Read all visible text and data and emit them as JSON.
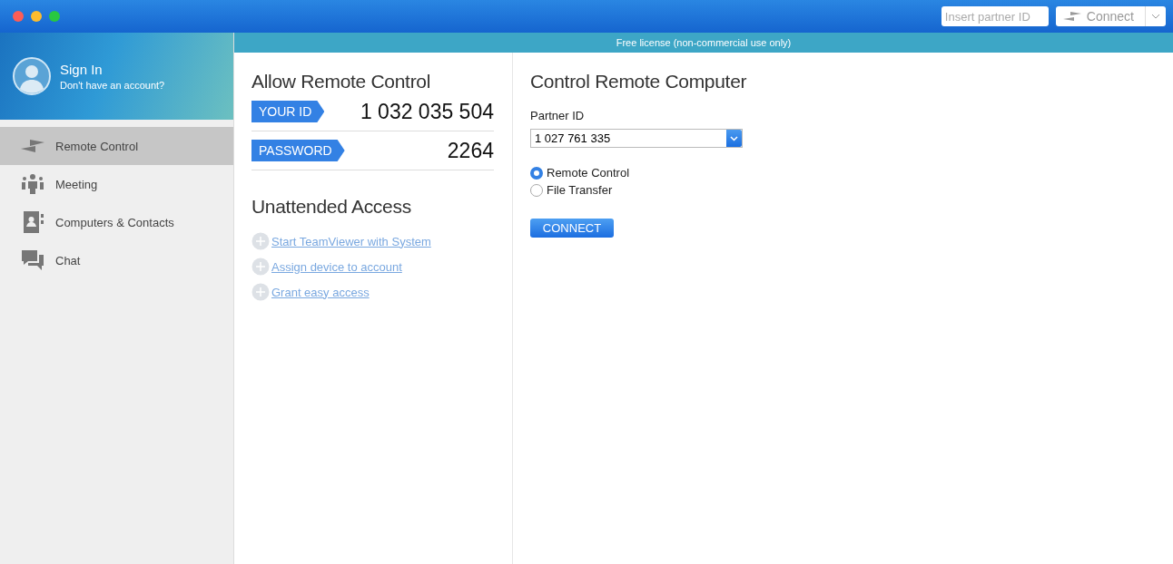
{
  "toolbar": {
    "partner_field": {
      "placeholder": "Insert partner ID"
    },
    "connect_button": "Connect"
  },
  "banner": "Free license (non-commercial use only)",
  "account": {
    "title": "Sign In",
    "subtitle": "Don't have an account?"
  },
  "sidebar": {
    "items": [
      {
        "label": "Remote Control",
        "kind": "arrows",
        "selected": true
      },
      {
        "label": "Meeting",
        "kind": "people",
        "selected": false
      },
      {
        "label": "Computers & Contacts",
        "kind": "contacts",
        "selected": false
      },
      {
        "label": "Chat",
        "kind": "chat",
        "selected": false
      }
    ]
  },
  "allow": {
    "title": "Allow Remote Control",
    "rows": [
      {
        "label": "YOUR ID",
        "value": "1 032 035 504"
      },
      {
        "label": "PASSWORD",
        "value": "2264"
      }
    ]
  },
  "unattended": {
    "title": "Unattended Access",
    "links": [
      "Start TeamViewer with System",
      "Assign device to account",
      "Grant easy access"
    ]
  },
  "control": {
    "title": "Control Remote Computer",
    "field_label": "Partner ID",
    "partner_id": "1 027 761 335",
    "options": [
      {
        "label": "Remote Control",
        "selected": true
      },
      {
        "label": "File Transfer",
        "selected": false
      }
    ],
    "button": "CONNECT"
  }
}
